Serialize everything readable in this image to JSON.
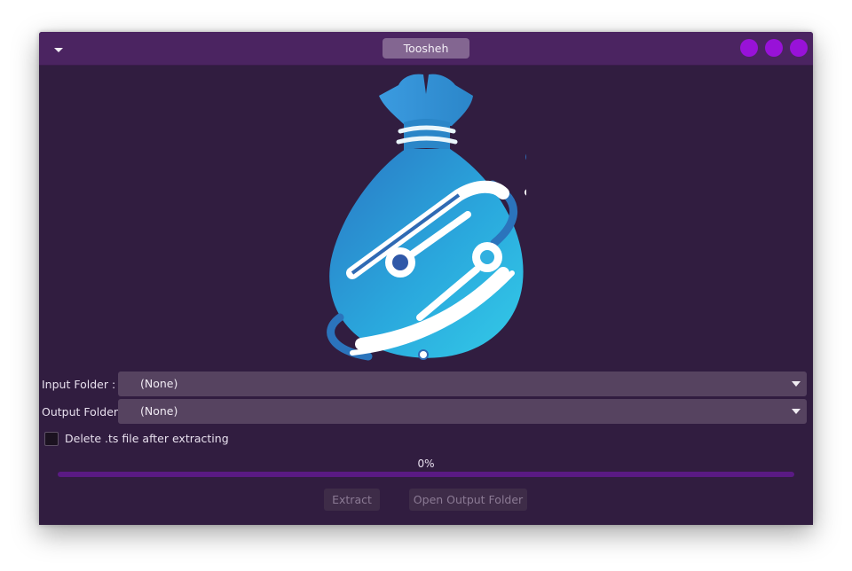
{
  "window": {
    "title": "Toosheh"
  },
  "form": {
    "input_label": "Input Folder :",
    "input_value": "(None)",
    "output_label": "Output Folder :",
    "output_value": "(None)",
    "delete_ts_label": "Delete .ts file after extracting",
    "delete_ts_checked": false
  },
  "progress": {
    "text": "0%",
    "value": 0
  },
  "buttons": {
    "extract": "Extract",
    "open_output": "Open Output Folder"
  },
  "colors": {
    "titlebar": "#4b2461",
    "window_bg": "#311d40",
    "accent": "#9812d8",
    "combo_bg": "#564360",
    "progress_track": "#5a1a84"
  },
  "icons": {
    "menu": "chevron-down-icon",
    "logo": "toosheh-bag-logo"
  }
}
